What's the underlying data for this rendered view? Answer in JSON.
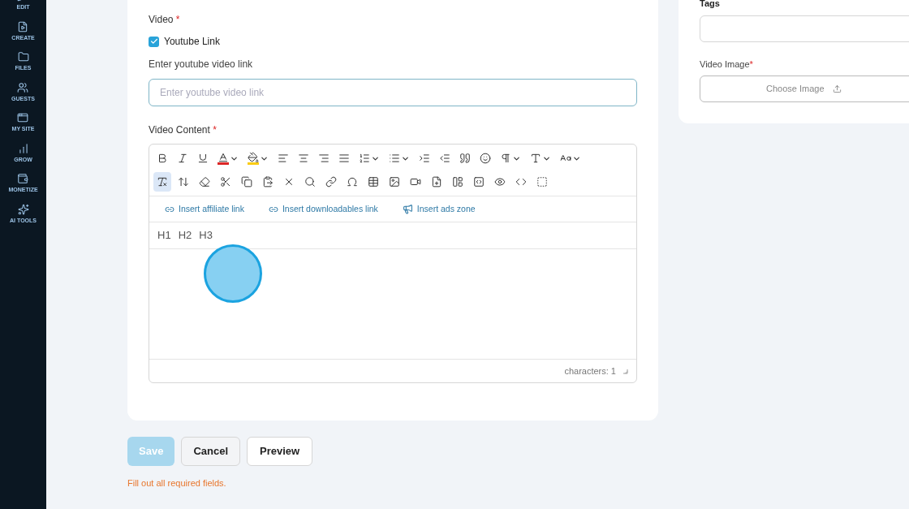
{
  "sidebar": {
    "items": [
      {
        "label": "EDIT"
      },
      {
        "label": "CREATE"
      },
      {
        "label": "FILES"
      },
      {
        "label": "GUESTS"
      },
      {
        "label": "MY SITE"
      },
      {
        "label": "GROW"
      },
      {
        "label": "MONETIZE"
      },
      {
        "label": "AI TOOLS"
      }
    ]
  },
  "video": {
    "label": "Video",
    "required_mark": "*",
    "youtube_checkbox": {
      "label": "Youtube Link",
      "checked": true
    },
    "link_label": "Enter youtube video link",
    "link_field": {
      "placeholder": "Enter youtube video link"
    }
  },
  "content": {
    "label": "Video Content",
    "required_mark": "*",
    "toolbar": [
      {
        "selected": false
      },
      {
        "selected": false
      },
      {
        "selected": false
      },
      {
        "selected": false
      },
      {
        "selected": false
      },
      {
        "selected": false
      },
      {
        "selected": false
      },
      {
        "selected": false
      },
      {
        "selected": false
      },
      {
        "selected": false
      },
      {
        "selected": false
      },
      {
        "selected": false
      },
      {
        "selected": false
      },
      {
        "selected": false
      },
      {
        "selected": false
      },
      {
        "selected": false
      },
      {
        "selected": false
      },
      {
        "selected": false
      },
      {
        "selected": true
      },
      {
        "selected": false
      },
      {
        "selected": false
      },
      {
        "selected": false
      },
      {
        "selected": false
      },
      {
        "selected": false
      },
      {
        "selected": false
      },
      {
        "selected": false
      },
      {
        "selected": false
      },
      {
        "selected": false
      },
      {
        "selected": false
      },
      {
        "selected": false
      },
      {
        "selected": false
      },
      {
        "selected": false
      },
      {
        "selected": false
      },
      {
        "selected": false
      },
      {
        "selected": false
      },
      {
        "selected": false
      },
      {
        "selected": false
      }
    ],
    "insert_links": [
      {
        "label": "Insert affiliate link",
        "kind": "link"
      },
      {
        "label": "Insert downloadables link",
        "kind": "link"
      },
      {
        "label": "Insert ads zone",
        "kind": "ads"
      }
    ],
    "headings": [
      "H1",
      "H2",
      "H3"
    ],
    "counter": "characters: 1"
  },
  "actions": {
    "save": {
      "label": "Save",
      "disabled": true
    },
    "cancel": {
      "label": "Cancel"
    },
    "preview": {
      "label": "Preview"
    },
    "error": "Fill out all required fields."
  },
  "side": {
    "tags_label": "Tags",
    "image_label": "Video Image",
    "image_required_mark": "*",
    "choose_image": "Choose Image"
  }
}
